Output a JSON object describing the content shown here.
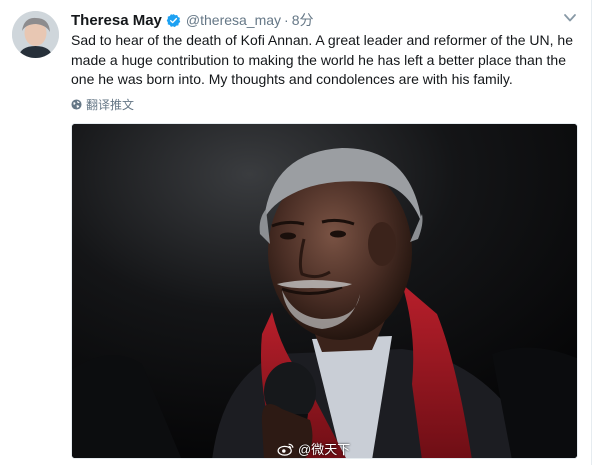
{
  "tweet": {
    "author_name": "Theresa May",
    "handle": "@theresa_may",
    "separator": "·",
    "time": "8分",
    "text": "Sad to hear of the death of Kofi Annan. A great leader and reformer of the UN, he made a huge contribution to making the world he has left a better place than the one he was born into. My thoughts and condolences are with his family.",
    "translate_label": "翻译推文"
  },
  "icons": {
    "verified": "verified-badge-icon",
    "caret": "chevron-down-icon",
    "translate": "globe-icon",
    "watermark": "weibo-logo-icon"
  },
  "watermark": {
    "text": "@微天下"
  },
  "colors": {
    "accent": "#1da1f2",
    "secondary_text": "#657786",
    "scarf": "#b81f2b"
  }
}
